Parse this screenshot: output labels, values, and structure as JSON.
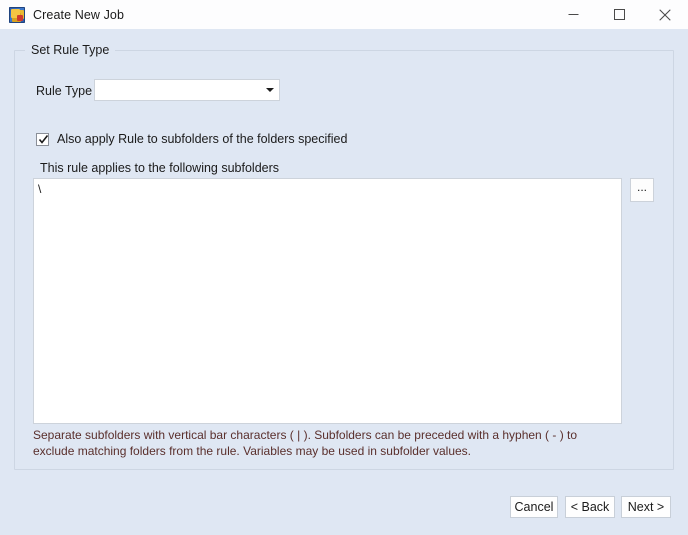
{
  "window": {
    "title": "Create New Job",
    "icon": "app-icon",
    "controls": {
      "minimize": "minimize-icon",
      "maximize": "maximize-icon",
      "close": "close-icon"
    }
  },
  "groupbox": {
    "legend": "Set Rule Type"
  },
  "rule_type": {
    "label": "Rule Type",
    "value": "",
    "placeholder": "",
    "arrow_icon": "chevron-down-icon",
    "options": []
  },
  "subfolders": {
    "checkbox_label": "Also apply Rule to subfolders of the folders specified",
    "checkbox_checked": true,
    "caption": "This rule applies to the following subfolders",
    "textarea_value": "\\",
    "browse_label": "...",
    "hint": "Separate subfolders with vertical bar characters ( | ). Subfolders can be preceded with a hyphen ( - ) to exclude matching folders from the rule. Variables may be used in subfolder values."
  },
  "buttons": {
    "cancel": "Cancel",
    "back": "< Back",
    "next": "Next >"
  },
  "colors": {
    "dialog_background": "#dfe7f3",
    "titlebar_background": "#fdfdfe",
    "field_background": "#ffffff",
    "border": "#cdd6e3",
    "hint_text": "#5a2f2c",
    "text": "#1b1b1b"
  }
}
